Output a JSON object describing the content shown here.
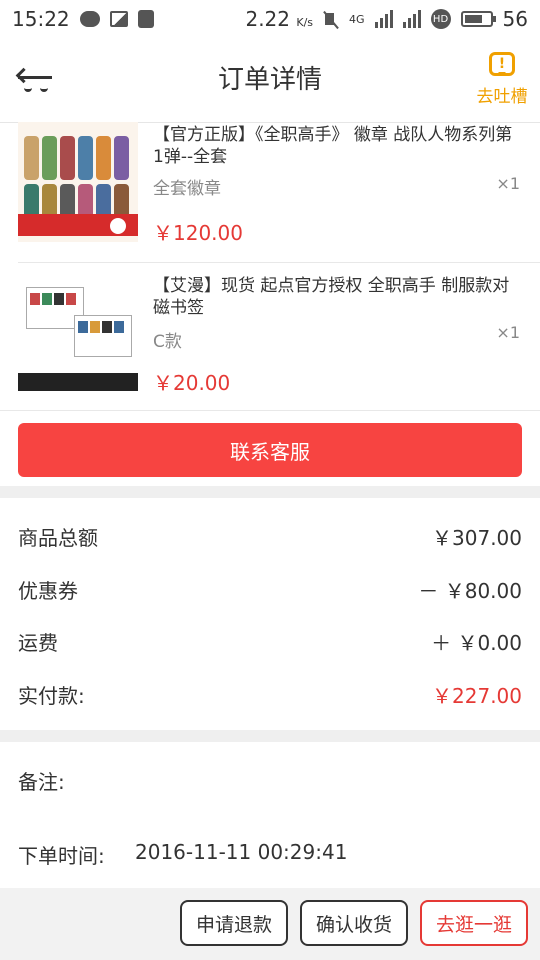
{
  "status_bar": {
    "time": "15:22",
    "speed": "2.22",
    "speed_unit": "K/s",
    "network": "4G",
    "hd": "HD",
    "battery": "56"
  },
  "nav": {
    "title": "订单详情",
    "complain_label": "去吐槽"
  },
  "items": [
    {
      "title": "【官方正版】《全职高手》 徽章 战队人物系列第1弹--全套",
      "spec": "全套徽章",
      "qty": "×1",
      "price": "￥120.00"
    },
    {
      "title": "【艾漫】现货 起点官方授权 全职高手 制服款对磁书签",
      "spec": "C款",
      "qty": "×1",
      "price": "￥20.00"
    }
  ],
  "contact_label": "联系客服",
  "summary": {
    "goods_total_label": "商品总额",
    "goods_total_value": "￥307.00",
    "coupon_label": "优惠券",
    "coupon_value": "－ ￥80.00",
    "shipping_label": "运费",
    "shipping_value": "＋ ￥0.00",
    "paid_label": "实付款:",
    "paid_value": "￥227.00"
  },
  "remark_label": "备注:",
  "order_time_label": "下单时间:",
  "order_time_value": "2016-11-11 00:29:41",
  "footer": {
    "refund_label": "申请退款",
    "confirm_label": "确认收货",
    "browse_label": "去逛一逛"
  },
  "colors": {
    "accent_red": "#f74441",
    "price_red": "#e53935",
    "complain_orange": "#f0a000"
  },
  "icons": {
    "back": "back-icon",
    "complain": "feedback-icon"
  }
}
